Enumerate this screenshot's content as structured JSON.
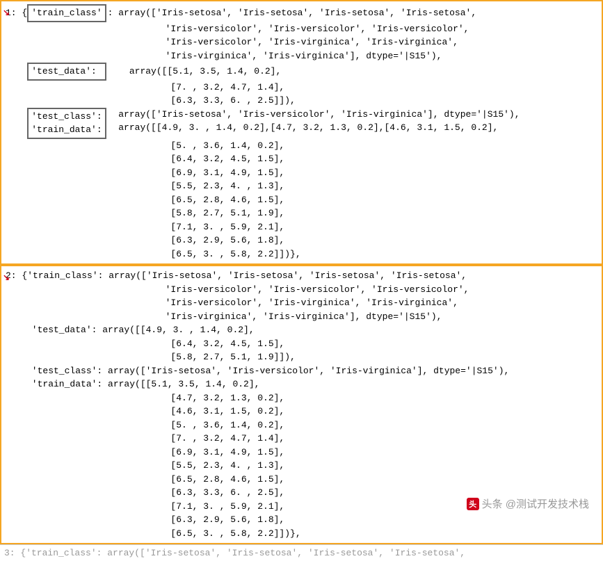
{
  "section1": {
    "prefix": "1: {",
    "box1": "'train_class'",
    "line1a": ": array(['Iris-setosa', 'Iris-setosa', 'Iris-setosa', 'Iris-setosa',",
    "line1b": "       'Iris-versicolor', 'Iris-versicolor', 'Iris-versicolor',",
    "line1c": "       'Iris-versicolor', 'Iris-virginica', 'Iris-virginica',",
    "line1d": "       'Iris-virginica', 'Iris-virginica'], dtype='|S15'),",
    "box2": "'test_data': ",
    "line2a": " array([[5.1, 3.5, 1.4, 0.2],",
    "line2b": "        [7. , 3.2, 4.7, 1.4],",
    "line2c": "        [6.3, 3.3, 6. , 2.5]]),",
    "box3a": "'test_class':",
    "box3b": "'train_data':",
    "line3a": "  array(['Iris-setosa', 'Iris-versicolor', 'Iris-virginica'], dtype='|S15'),",
    "line3b": "  array([[4.9, 3. , 1.4, 0.2],[4.7, 3.2, 1.3, 0.2],[4.6, 3.1, 1.5, 0.2],",
    "rows": [
      "        [5. , 3.6, 1.4, 0.2],",
      "        [6.4, 3.2, 4.5, 1.5],",
      "        [6.9, 3.1, 4.9, 1.5],",
      "        [5.5, 2.3, 4. , 1.3],",
      "        [6.5, 2.8, 4.6, 1.5],",
      "        [5.8, 2.7, 5.1, 1.9],",
      "        [7.1, 3. , 5.9, 2.1],",
      "        [6.3, 2.9, 5.6, 1.8],",
      "        [6.5, 3. , 5.8, 2.2]])},"
    ]
  },
  "section2": {
    "prefix": "2: {'train_class': array(['Iris-setosa', 'Iris-setosa', 'Iris-setosa', 'Iris-setosa',",
    "l2": "       'Iris-versicolor', 'Iris-versicolor', 'Iris-versicolor',",
    "l3": "       'Iris-versicolor', 'Iris-virginica', 'Iris-virginica',",
    "l4": "       'Iris-virginica', 'Iris-virginica'], dtype='|S15'),",
    "test_data1": " 'test_data': array([[4.9, 3. , 1.4, 0.2],",
    "test_data2": "        [6.4, 3.2, 4.5, 1.5],",
    "test_data3": "        [5.8, 2.7, 5.1, 1.9]]),",
    "test_class": " 'test_class': array(['Iris-setosa', 'Iris-versicolor', 'Iris-virginica'], dtype='|S15'),",
    "train_data1": " 'train_data': array([[5.1, 3.5, 1.4, 0.2],",
    "rows": [
      "        [4.7, 3.2, 1.3, 0.2],",
      "        [4.6, 3.1, 1.5, 0.2],",
      "        [5. , 3.6, 1.4, 0.2],",
      "        [7. , 3.2, 4.7, 1.4],",
      "        [6.9, 3.1, 4.9, 1.5],",
      "        [5.5, 2.3, 4. , 1.3],",
      "        [6.5, 2.8, 4.6, 1.5],",
      "        [6.3, 3.3, 6. , 2.5],",
      "        [7.1, 3. , 5.9, 2.1],",
      "        [6.3, 2.9, 5.6, 1.8],",
      "        [6.5, 3. , 5.8, 2.2]])},"
    ]
  },
  "bottom": "3: {'train_class': array(['Iris-setosa', 'Iris-setosa', 'Iris-setosa', 'Iris-setosa',",
  "watermark": "头条 @测试开发技术栈",
  "arrow": "↘"
}
